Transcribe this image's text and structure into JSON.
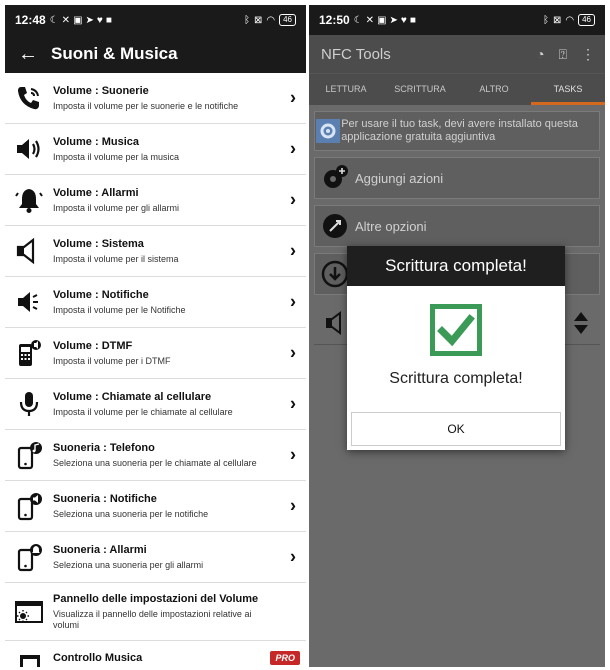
{
  "left": {
    "status": {
      "time": "12:48",
      "battery": "46"
    },
    "appbar": {
      "title": "Suoni & Musica"
    },
    "items": [
      {
        "title": "Volume : Suonerie",
        "subtitle": "Imposta il volume per le suonerie e le notifiche",
        "icon": "phone-ring-icon"
      },
      {
        "title": "Volume : Musica",
        "subtitle": "Imposta il volume per la musica",
        "icon": "speaker-icon"
      },
      {
        "title": "Volume : Allarmi",
        "subtitle": "Imposta il volume per gli allarmi",
        "icon": "bell-icon"
      },
      {
        "title": "Volume : Sistema",
        "subtitle": "Imposta il volume per il sistema",
        "icon": "speaker-outline-icon"
      },
      {
        "title": "Volume : Notifiche",
        "subtitle": "Imposta il volume per le Notifiche",
        "icon": "speaker-notification-icon"
      },
      {
        "title": "Volume : DTMF",
        "subtitle": "Imposta il volume per i DTMF",
        "icon": "dialpad-phone-icon"
      },
      {
        "title": "Volume : Chiamate al cellulare",
        "subtitle": "Imposta il volume per le chiamate al cellulare",
        "icon": "microphone-icon"
      },
      {
        "title": "Suoneria : Telefono",
        "subtitle": "Seleziona una suoneria per le chiamate al cellulare",
        "icon": "phone-note-icon"
      },
      {
        "title": "Suoneria : Notifiche",
        "subtitle": "Seleziona una suoneria per le notifiche",
        "icon": "phone-speaker-icon"
      },
      {
        "title": "Suoneria : Allarmi",
        "subtitle": "Seleziona una suoneria per gli allarmi",
        "icon": "phone-bell-icon"
      },
      {
        "title": "Pannello delle impostazioni del Volume",
        "subtitle": "Visualizza il pannello delle impostazioni relative ai volumi",
        "icon": "volume-panel-icon"
      },
      {
        "title": "Controllo Musica",
        "subtitle": "",
        "icon": "music-note-icon",
        "badge": "PRO"
      }
    ]
  },
  "right": {
    "status": {
      "time": "12:50",
      "battery": "46"
    },
    "appbar": {
      "title": "NFC Tools"
    },
    "tabs": [
      "LETTURA",
      "SCRITTURA",
      "ALTRO",
      "TASKS"
    ],
    "active_tab": "TASKS",
    "notice": "Per usare il tuo task, devi avere installato questa applicazione gratuita aggiuntiva",
    "add_actions": "Aggiungi azioni",
    "more_options": "Altre opzioni",
    "dialog": {
      "title": "Scrittura completa!",
      "message": "Scrittura completa!",
      "ok": "OK"
    }
  },
  "colors": {
    "check_green": "#3a9a56",
    "tab_accent": "#d2691e",
    "pro_red": "#c62828"
  }
}
